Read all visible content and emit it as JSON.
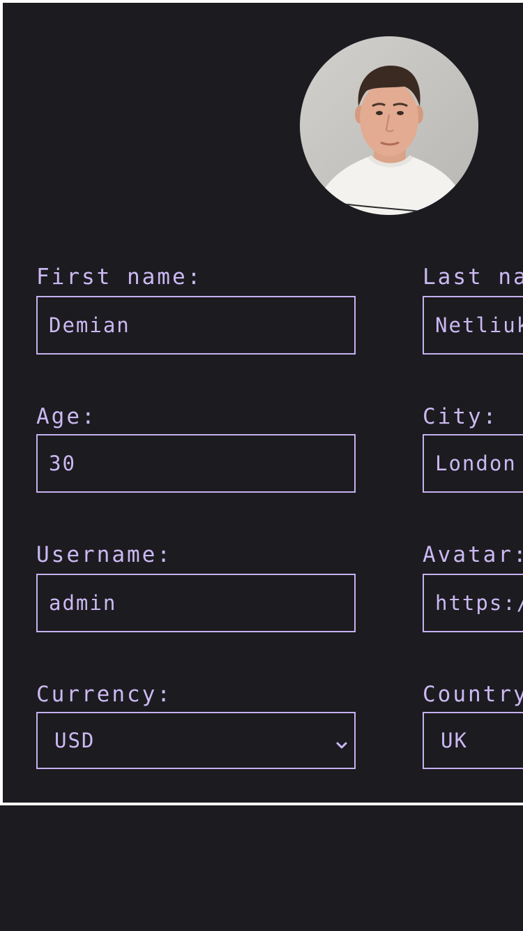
{
  "profile": {
    "avatar_alt": "Profile photo"
  },
  "fields": {
    "first_name": {
      "label": "First name:",
      "value": "Demian"
    },
    "last_name": {
      "label": "Last name:",
      "value": "Netliuk"
    },
    "age": {
      "label": "Age:",
      "value": "30"
    },
    "city": {
      "label": "City:",
      "value": "London"
    },
    "username": {
      "label": "Username:",
      "value": "admin"
    },
    "avatar": {
      "label": "Avatar:",
      "value": "https://"
    },
    "currency": {
      "label": "Currency:",
      "value": "USD",
      "icon": "chevron-down-icon"
    },
    "country": {
      "label": "Country:",
      "value": "UK",
      "icon": "chevron-down-icon"
    }
  },
  "colors": {
    "background": "#1c1b20",
    "accent": "#cbb9f2",
    "border": "#c5b2f0",
    "frame": "#ffffff"
  }
}
